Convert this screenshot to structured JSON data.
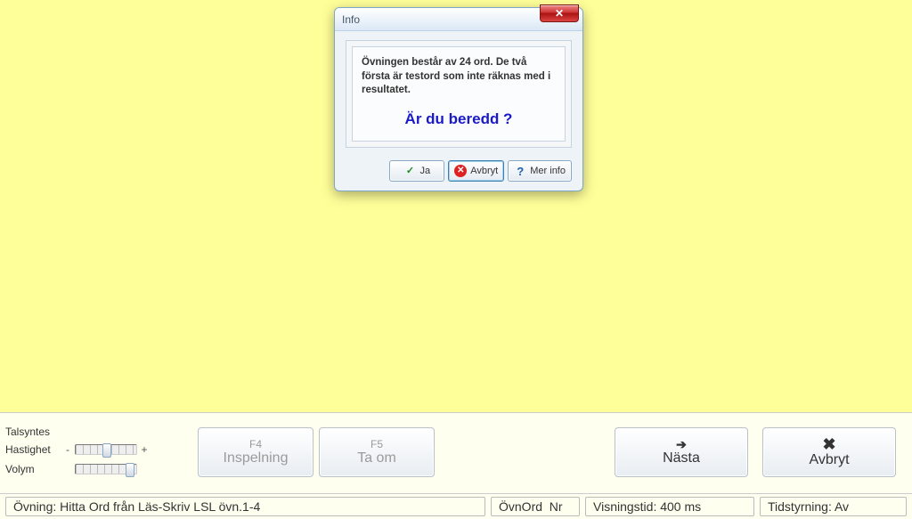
{
  "dialog": {
    "title": "Info",
    "message": "Övningen består av 24 ord. De två första är testord som inte räknas med i resultatet.",
    "prompt": "Är du beredd ?",
    "buttons": {
      "yes": "Ja",
      "cancel": "Avbryt",
      "more": "Mer info"
    }
  },
  "talsyntes": {
    "title": "Talsyntes",
    "speed_label": "Hastighet",
    "volume_label": "Volym"
  },
  "controls": {
    "f4_key": "F4",
    "f4_label": "Inspelning",
    "f5_key": "F5",
    "f5_label": "Ta om",
    "next": "Nästa",
    "abort": "Avbryt"
  },
  "status": {
    "ovning": "Övning: Hitta Ord från Läs-Skriv LSL övn.1-4",
    "ovnord_label": "ÖvnOrd",
    "nr_label": "Nr",
    "visningstid": "Visningstid: 400 ms",
    "tidstyrning": "Tidstyrning: Av"
  }
}
